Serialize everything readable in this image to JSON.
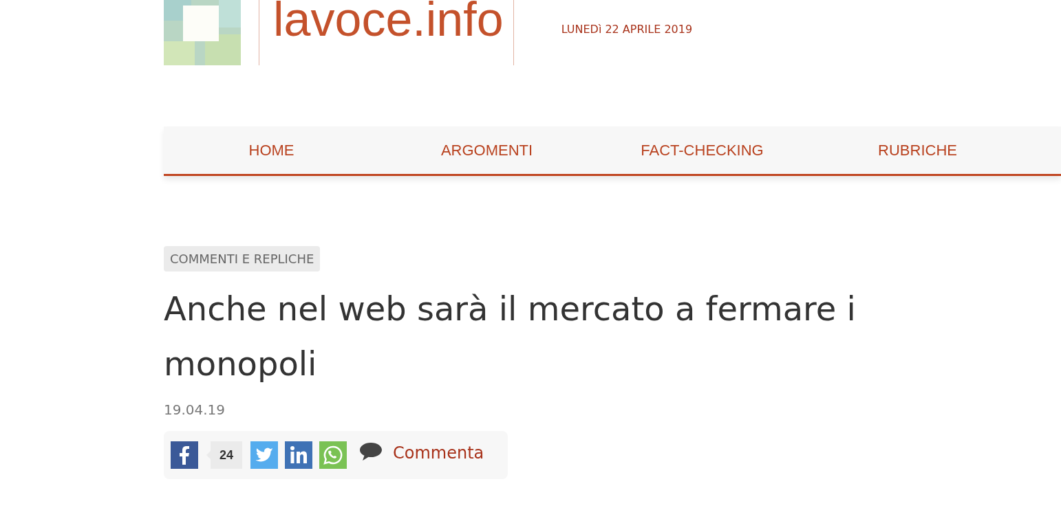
{
  "header": {
    "logo_text": "lavoce.info",
    "date": "LUNEDì 22 APRILE 2019"
  },
  "nav": {
    "items": [
      {
        "label": "HOME"
      },
      {
        "label": "ARGOMENTI"
      },
      {
        "label": "FACT-CHECKING"
      },
      {
        "label": "RUBRICHE"
      }
    ]
  },
  "article": {
    "category": "COMMENTI E REPLICHE",
    "title": "Anche nel web sarà il mercato a fermare i monopoli",
    "date": "19.04.19"
  },
  "share_bar": {
    "facebook_count": "24",
    "comment_label": "Commenta"
  }
}
